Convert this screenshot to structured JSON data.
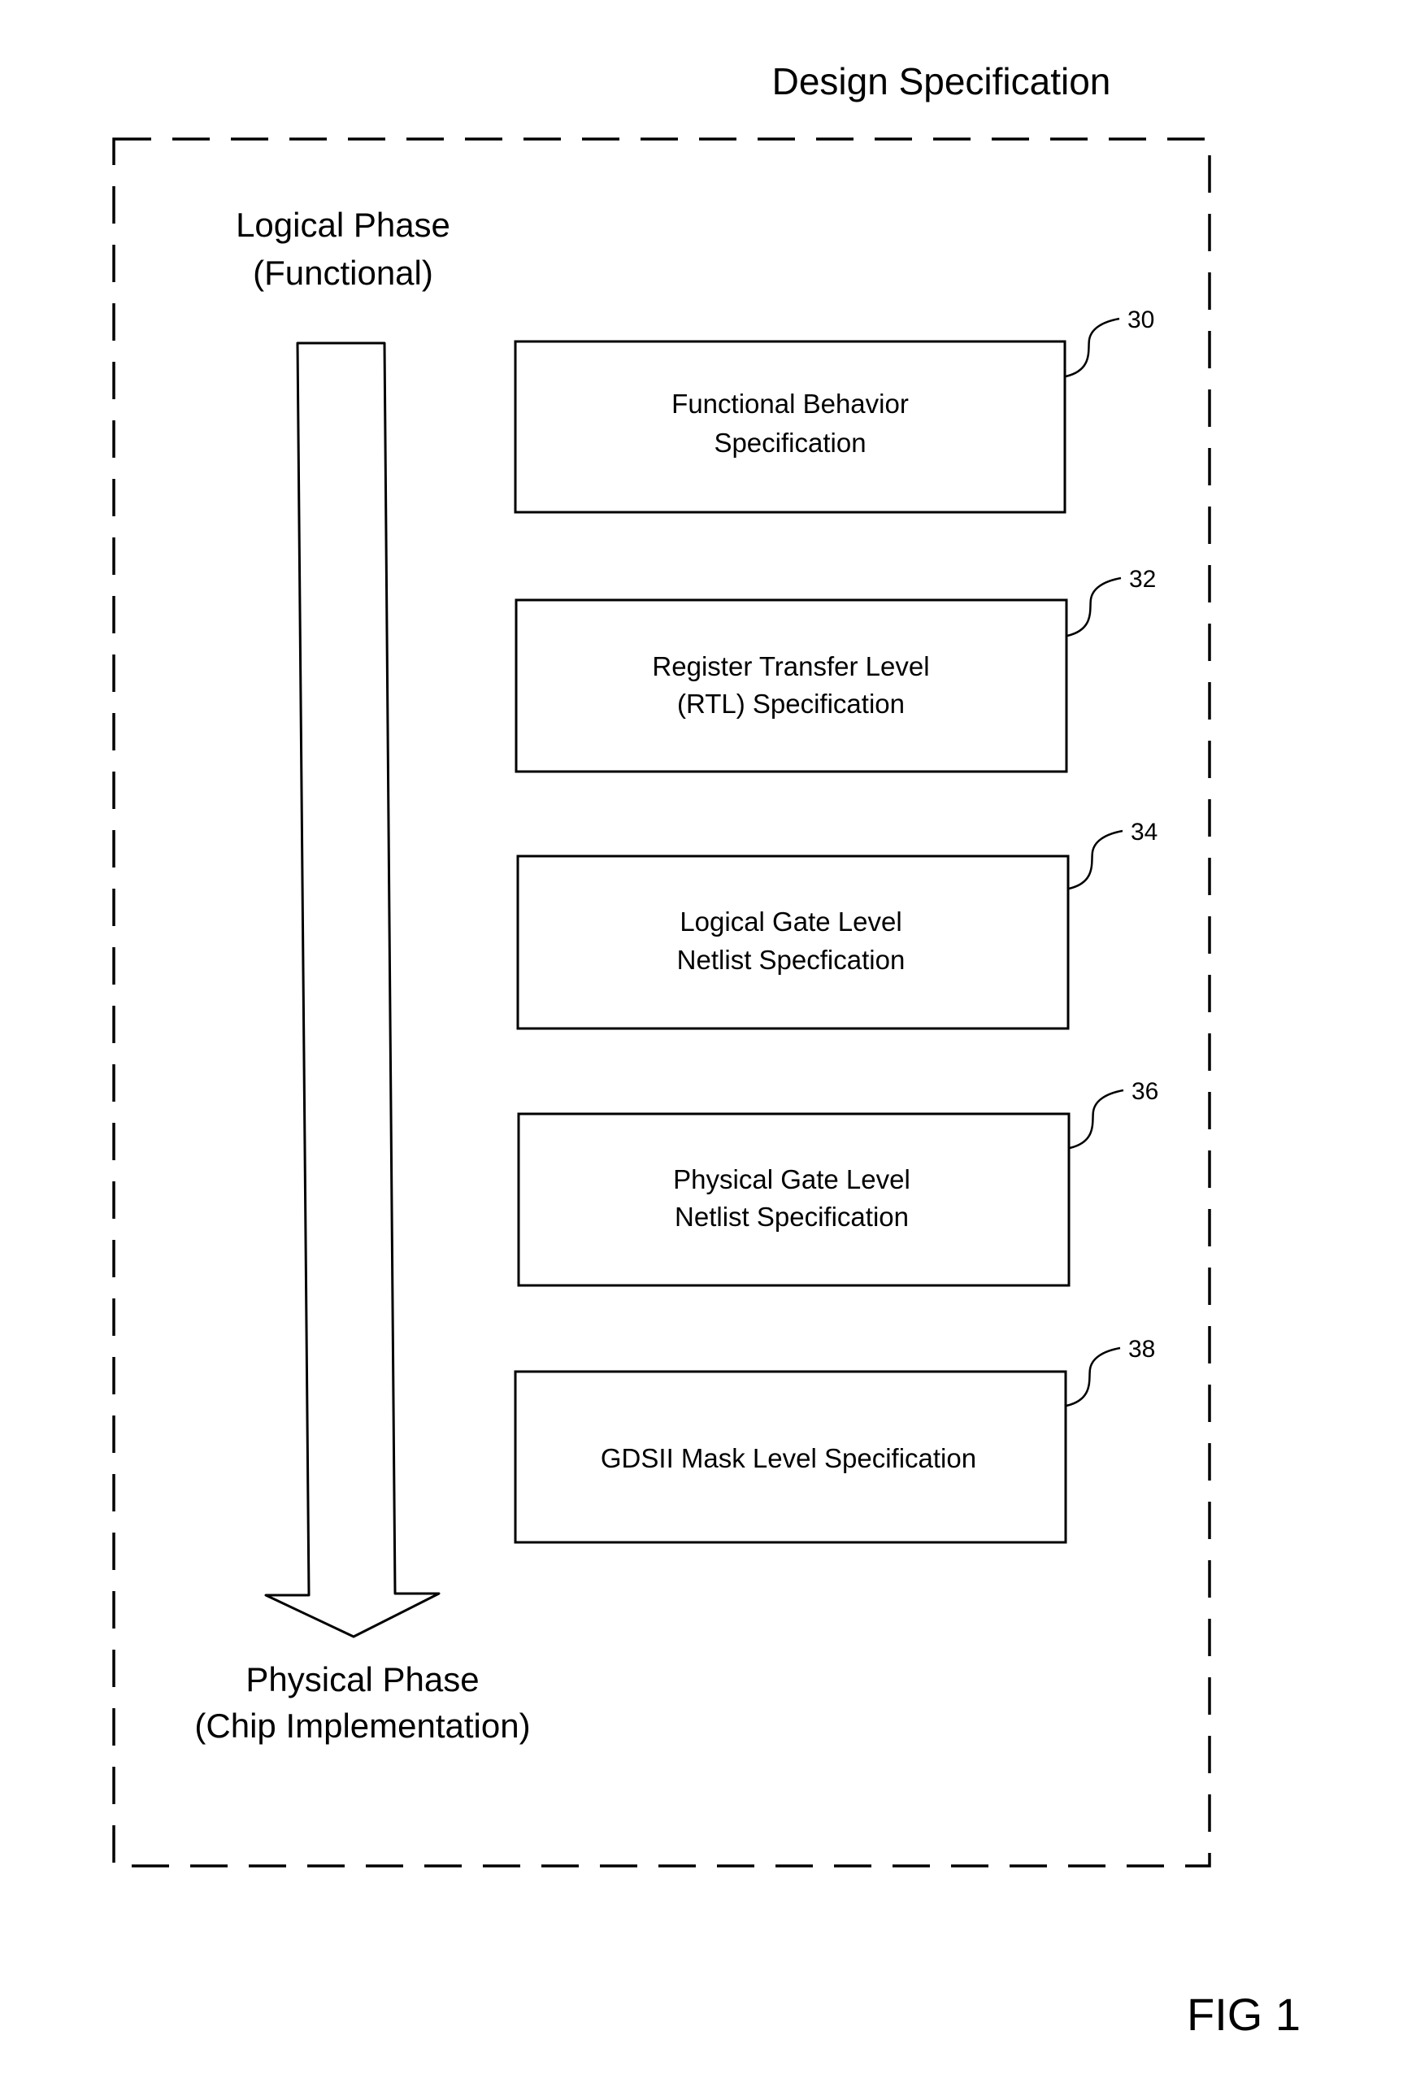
{
  "title": "Design Specification",
  "logical_phase": {
    "line1": "Logical Phase",
    "line2": "(Functional)"
  },
  "physical_phase": {
    "line1": "Physical Phase",
    "line2": "(Chip Implementation)"
  },
  "arrow_direction": "down",
  "boxes": [
    {
      "ref": "30",
      "lines": [
        "Functional Behavior",
        "Specification"
      ]
    },
    {
      "ref": "32",
      "lines": [
        "Register Transfer Level",
        "(RTL) Specification"
      ]
    },
    {
      "ref": "34",
      "lines": [
        "Logical Gate Level",
        "Netlist Specfication"
      ]
    },
    {
      "ref": "36",
      "lines": [
        "Physical Gate Level",
        "Netlist Specification"
      ]
    },
    {
      "ref": "38",
      "lines": [
        "GDSII Mask Level Specification"
      ]
    }
  ],
  "figure_label": "FIG 1",
  "colors": {
    "ink": "#000000",
    "paper": "#ffffff"
  }
}
